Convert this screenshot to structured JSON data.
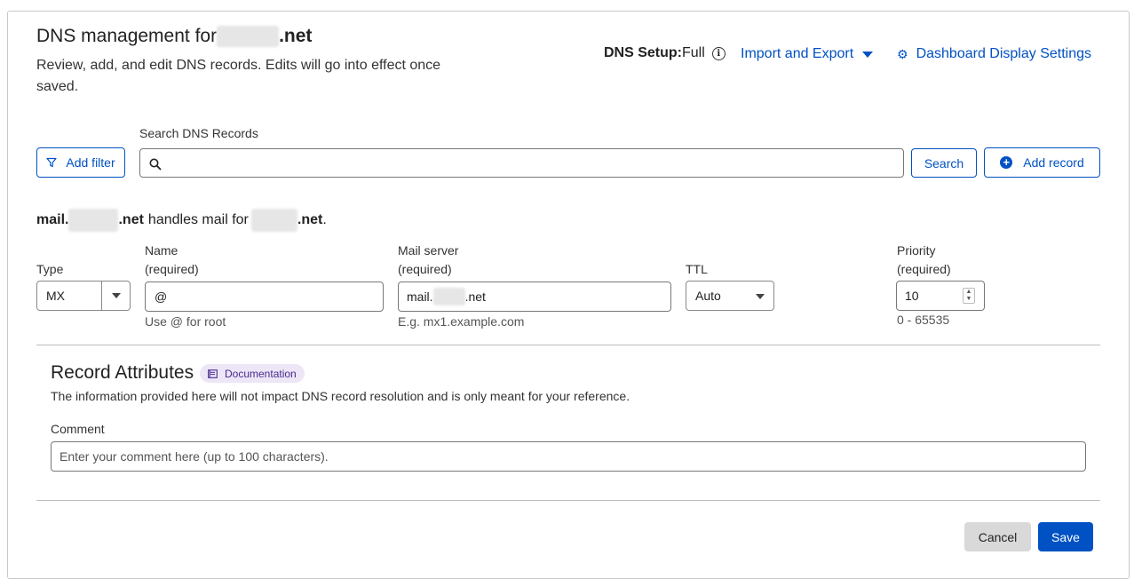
{
  "header": {
    "title_prefix": "DNS management for",
    "title_suffix": ".net",
    "subtitle": "Review, add, and edit DNS records. Edits will go into effect once saved.",
    "dns_setup_label": "DNS Setup:",
    "dns_setup_value": "Full",
    "import_export": "Import and Export",
    "dashboard_settings": "Dashboard Display Settings"
  },
  "toolbar": {
    "add_filter": "Add filter",
    "search_label": "Search DNS Records",
    "search_placeholder": "",
    "search_button": "Search",
    "add_record": "Add record"
  },
  "mail_line": {
    "mail_prefix": "mail.",
    "mail_suffix": ".net",
    "handles": "handles mail for",
    "domain_suffix": ".net",
    "period": "."
  },
  "form": {
    "type_label": "Type",
    "type_value": "MX",
    "name_label": "Name",
    "name_required": "(required)",
    "name_value": "@",
    "name_hint": "Use @ for root",
    "mail_server_label": "Mail server",
    "mail_server_required": "(required)",
    "mail_server_prefix": "mail.",
    "mail_server_suffix": ".net",
    "mail_server_hint": "E.g. mx1.example.com",
    "ttl_label": "TTL",
    "ttl_value": "Auto",
    "priority_label": "Priority",
    "priority_required": "(required)",
    "priority_value": "10",
    "priority_hint": "0 - 65535"
  },
  "attributes": {
    "title": "Record Attributes",
    "doc_badge": "Documentation",
    "description": "The information provided here will not impact DNS record resolution and is only meant for your reference.",
    "comment_label": "Comment",
    "comment_placeholder": "Enter your comment here (up to 100 characters)."
  },
  "actions": {
    "cancel": "Cancel",
    "save": "Save"
  },
  "colors": {
    "accent": "#0051c3",
    "badge_bg": "#ece6f6",
    "cancel_bg": "#d9d9d9"
  }
}
